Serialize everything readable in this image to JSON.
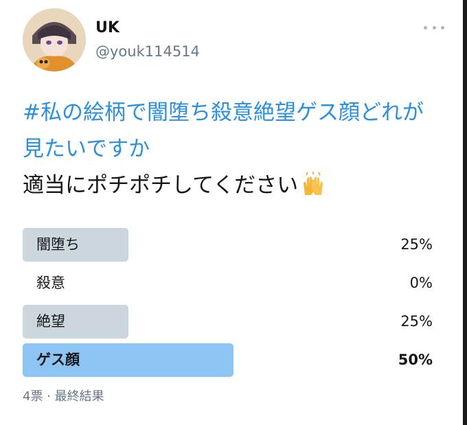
{
  "user": {
    "display_name": "UK",
    "handle": "@youk114514"
  },
  "tweet": {
    "hashtag": "#私の絵柄で闇堕ち殺意絶望ゲス顔どれが見たいですか",
    "body": "適当にポチポチしてください",
    "emoji_icon": "raising-hands-emoji"
  },
  "poll": {
    "options": [
      {
        "label": "闇堕ち",
        "percent_text": "25%",
        "percent": 25,
        "winner": false
      },
      {
        "label": "殺意",
        "percent_text": "0%",
        "percent": 0,
        "winner": false
      },
      {
        "label": "絶望",
        "percent_text": "25%",
        "percent": 25,
        "winner": false
      },
      {
        "label": "ゲス顔",
        "percent_text": "50%",
        "percent": 50,
        "winner": true
      }
    ],
    "meta": "4票 · 最終結果"
  },
  "colors": {
    "hashtag": "#2b8fe0",
    "bar": "#ccd6dd",
    "winner_bar": "#8cc5f4"
  }
}
